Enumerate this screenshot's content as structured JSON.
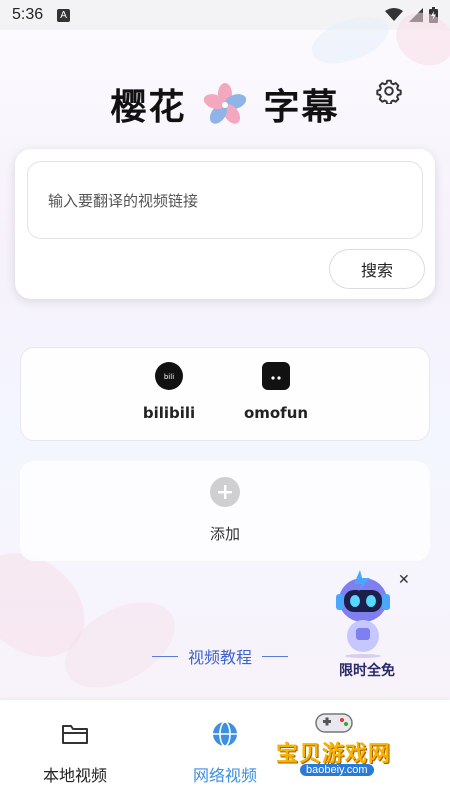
{
  "status_bar": {
    "time": "5:36",
    "a_badge": "A"
  },
  "header": {
    "title_left": "樱花",
    "title_right": "字幕",
    "settings_icon": "gear-icon"
  },
  "search": {
    "placeholder": "输入要翻译的视频链接",
    "button_label": "搜索"
  },
  "sources": [
    {
      "label": "bilibili",
      "icon": "bilibili-icon"
    },
    {
      "label": "omofun",
      "icon": "cat-icon"
    }
  ],
  "add": {
    "label": "添加"
  },
  "tutorial": {
    "label": "视频教程"
  },
  "promo": {
    "label": "限时全免"
  },
  "bottom_nav": {
    "items": [
      {
        "label": "本地视频",
        "icon": "folder-icon",
        "active": false
      },
      {
        "label": "网络视频",
        "icon": "globe-icon",
        "active": true
      },
      {
        "label": "",
        "icon": "",
        "active": false
      }
    ],
    "active_color": "#3d8fe0"
  },
  "watermark": {
    "title": "宝贝游戏网",
    "url": "baobeiy.com"
  }
}
